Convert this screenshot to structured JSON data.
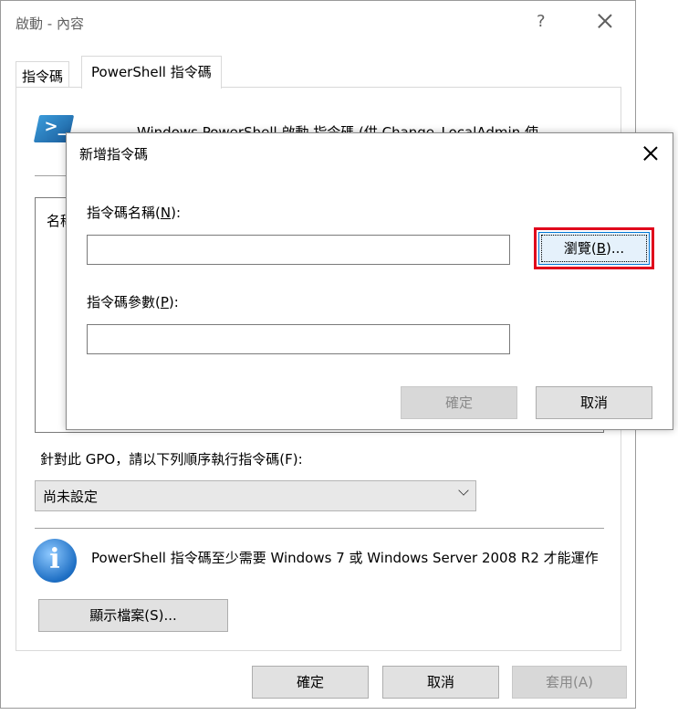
{
  "window": {
    "title": "啟動 - 內容",
    "help_label": "?"
  },
  "tabs": [
    {
      "label": "指令碼"
    },
    {
      "label": "PowerShell 指令碼"
    }
  ],
  "panel": {
    "description": "Windows PowerShell 啟動 指令碼 (供 Change_LocalAdmin 使",
    "list_header": "名稱",
    "order_label": "針對此 GPO，請以下列順序執行指令碼(F):",
    "order_select_value": "尚未設定",
    "info_text": "PowerShell 指令碼至少需要 Windows 7 或 Windows Server 2008 R2 才能運作",
    "show_files_label": "顯示檔案(S)..."
  },
  "footer": {
    "ok_label": "確定",
    "cancel_label": "取消",
    "apply_label": "套用(A)"
  },
  "dialog": {
    "title": "新增指令碼",
    "name_label_pre": "指令碼名稱(",
    "name_label_key": "N",
    "name_label_post": "):",
    "name_value": "",
    "params_label_pre": "指令碼參數(",
    "params_label_key": "P",
    "params_label_post": "):",
    "params_value": "",
    "browse_pre": "瀏覽(",
    "browse_key": "B",
    "browse_post": ")...",
    "ok_label": "確定",
    "cancel_label": "取消"
  },
  "colors": {
    "highlight": "#e0001b",
    "focus_border": "#0078d7"
  },
  "icons": {
    "powershell": "powershell-icon",
    "info": "info-icon",
    "close": "close-icon",
    "dropdown": "chevron-down-icon"
  }
}
